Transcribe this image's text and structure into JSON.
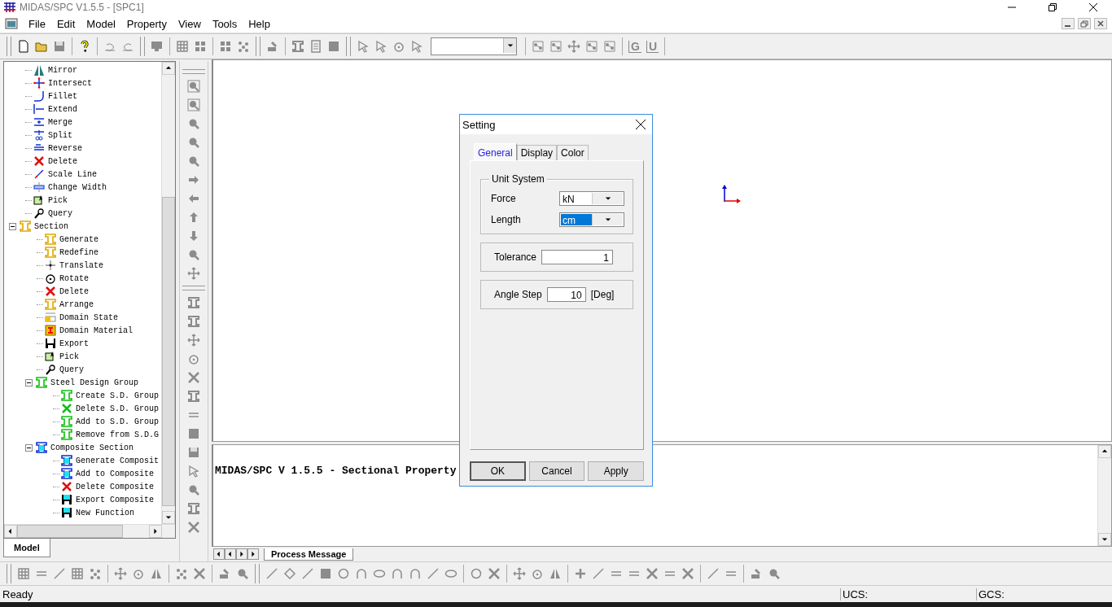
{
  "window": {
    "title": "MIDAS/SPC V1.5.5 - [SPC1]"
  },
  "menu": [
    "File",
    "Edit",
    "Model",
    "Property",
    "View",
    "Tools",
    "Help"
  ],
  "toolbar": {
    "letter_buttons": [
      "G",
      "U"
    ]
  },
  "tree": {
    "items_above": [
      "Mirror",
      "Intersect",
      "Fillet",
      "Extend",
      "Merge",
      "Split",
      "Reverse",
      "Delete",
      "Scale Line",
      "Change Width",
      "Pick",
      "Query"
    ],
    "nodes": [
      {
        "label": "Section",
        "expanded": true,
        "children": [
          {
            "label": "Generate"
          },
          {
            "label": "Redefine"
          },
          {
            "label": "Translate"
          },
          {
            "label": "Rotate"
          },
          {
            "label": "Delete"
          },
          {
            "label": "Arrange"
          },
          {
            "label": "Domain State"
          },
          {
            "label": "Domain Material"
          },
          {
            "label": "Export"
          },
          {
            "label": "Pick"
          },
          {
            "label": "Query"
          },
          {
            "label": "Steel Design Group",
            "expanded": true,
            "children": [
              {
                "label": "Create S.D. Group"
              },
              {
                "label": "Delete S.D. Group"
              },
              {
                "label": "Add to S.D. Group"
              },
              {
                "label": "Remove from S.D.G"
              }
            ]
          },
          {
            "label": "Composite Section",
            "expanded": true,
            "children": [
              {
                "label": "Generate Composit"
              },
              {
                "label": "Add to Composite"
              },
              {
                "label": "Delete Composite"
              },
              {
                "label": "Export Composite"
              },
              {
                "label": "New Function"
              }
            ]
          }
        ]
      }
    ]
  },
  "panel_tabs": [
    {
      "label": "Model",
      "selected": true
    }
  ],
  "message": {
    "text": "MIDAS/SPC V 1.5.5 - Sectional Property"
  },
  "message_tabs": [
    {
      "label": "Process Message",
      "selected": true
    }
  ],
  "dialog": {
    "title": "Setting",
    "tabs": [
      {
        "label": "General",
        "selected": true
      },
      {
        "label": "Display",
        "selected": false
      },
      {
        "label": "Color",
        "selected": false
      }
    ],
    "unit_system": {
      "title": "Unit System",
      "fields": [
        {
          "label": "Force",
          "value": "kN",
          "focused": false
        },
        {
          "label": "Length",
          "value": "cm",
          "focused": true
        }
      ]
    },
    "tolerance": {
      "label": "Tolerance",
      "value": "1"
    },
    "angle_step": {
      "label": "Angle Step",
      "value": "10",
      "unit": "[Deg]"
    },
    "buttons": [
      {
        "label": "OK",
        "default": true
      },
      {
        "label": "Cancel",
        "default": false
      },
      {
        "label": "Apply",
        "default": false
      }
    ]
  },
  "status": {
    "text": "Ready",
    "panes": [
      "UCS:",
      "GCS:"
    ]
  }
}
